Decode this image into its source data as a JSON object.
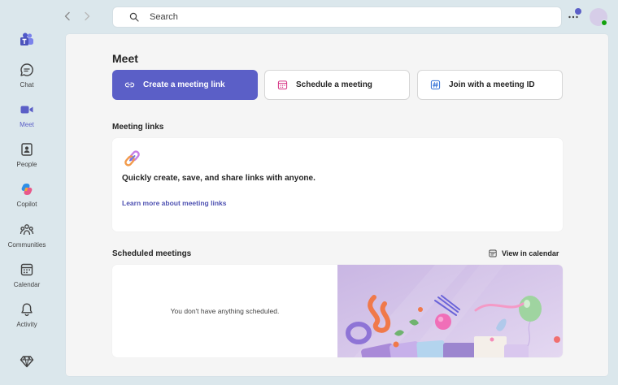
{
  "rail": {
    "items": [
      {
        "label": "Chat",
        "icon": "chat-icon"
      },
      {
        "label": "Meet",
        "icon": "video-camera-icon",
        "active": true
      },
      {
        "label": "People",
        "icon": "contact-card-icon"
      },
      {
        "label": "Copilot",
        "icon": "copilot-icon"
      },
      {
        "label": "Communities",
        "icon": "communities-icon"
      },
      {
        "label": "Calendar",
        "icon": "calendar-icon"
      },
      {
        "label": "Activity",
        "icon": "bell-icon"
      }
    ]
  },
  "topbar": {
    "search_placeholder": "Search"
  },
  "meet": {
    "title": "Meet",
    "actions": {
      "create_link": "Create a meeting link",
      "schedule": "Schedule a meeting",
      "join": "Join with a meeting ID"
    },
    "meeting_links": {
      "section_title": "Meeting links",
      "description": "Quickly create, save, and share links with anyone.",
      "learn_more": "Learn more about meeting links"
    },
    "scheduled": {
      "section_title": "Scheduled meetings",
      "view_calendar": "View in calendar",
      "empty_text": "You don't have anything scheduled."
    }
  },
  "colors": {
    "accent": "#5b5fc7",
    "background": "#dbe7ec",
    "panel": "#f5f5f5",
    "presence": "#13a10e"
  }
}
